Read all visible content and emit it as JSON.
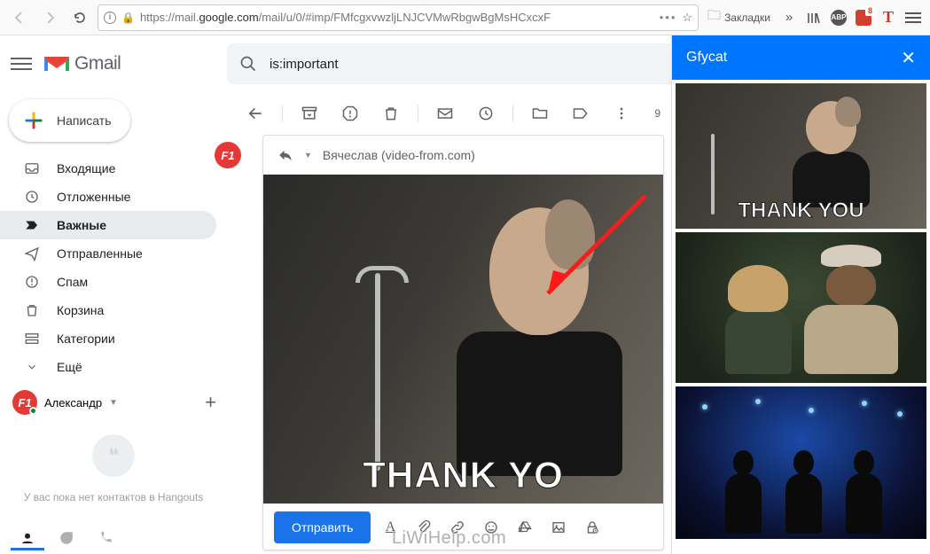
{
  "browser": {
    "url_prefix": "https://",
    "url_domain_gray1": "mail.",
    "url_domain": "google.com",
    "url_path_gray": "/mail/u/0/#imp/FMfcgxvwzljLNJCVMwRbgwBgMsHCxcxF",
    "bookmarks_label": "Закладки",
    "ext_badge": "8",
    "ext_t": "T"
  },
  "header": {
    "product": "Gmail",
    "search_value": "is:important"
  },
  "compose_btn": "Написать",
  "nav": {
    "inbox": "Входящие",
    "snoozed": "Отложенные",
    "important": "Важные",
    "sent": "Отправленные",
    "spam": "Спам",
    "trash": "Корзина",
    "categories": "Категории",
    "more": "Ещё"
  },
  "hangouts": {
    "user": "Александр",
    "empty": "У вас пока нет контактов в Hangouts"
  },
  "toolbar": {
    "counter": "9"
  },
  "compose": {
    "recipient": "Вячеслав (video-from.com)",
    "gif_caption": "THANK YO",
    "send": "Отправить"
  },
  "panel": {
    "title": "Gfycat",
    "thumb1_caption": "THANK YOU"
  },
  "watermark": "LiWiHelp.com"
}
